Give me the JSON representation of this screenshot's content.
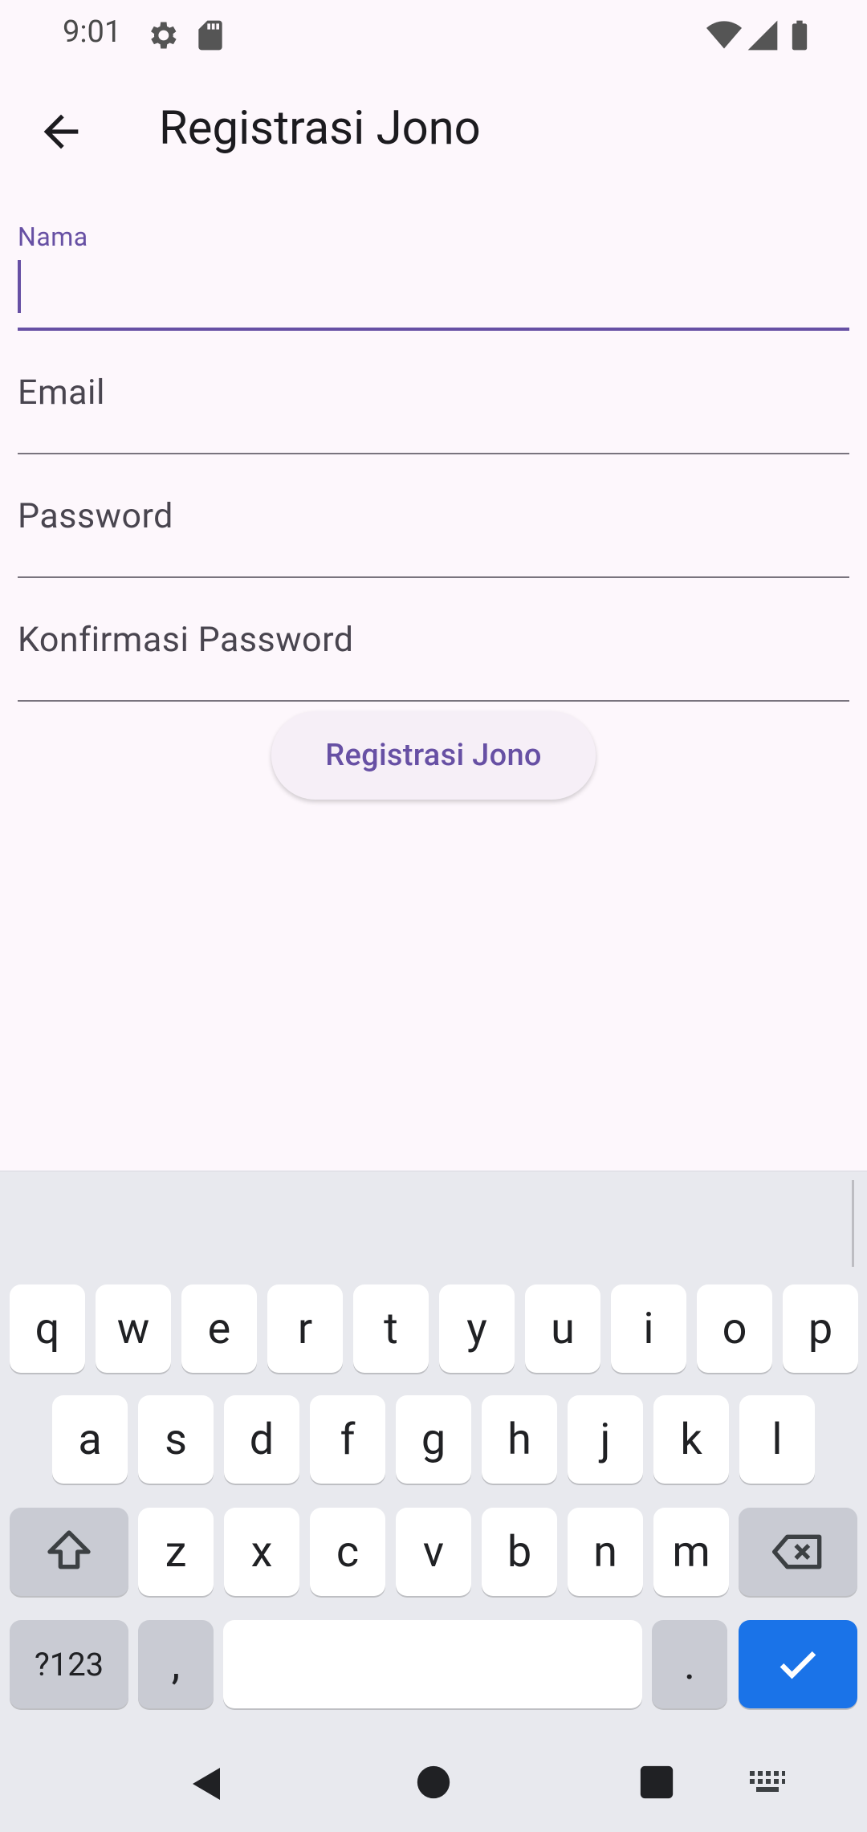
{
  "status": {
    "time": "9:01"
  },
  "appbar": {
    "title": "Registrasi Jono"
  },
  "form": {
    "fields": [
      {
        "label": "Nama",
        "value": ""
      },
      {
        "label": "Email",
        "value": ""
      },
      {
        "label": "Password",
        "value": ""
      },
      {
        "label": "Konfirmasi Password",
        "value": ""
      }
    ],
    "submit_label": "Registrasi Jono"
  },
  "keyboard": {
    "row1": [
      "q",
      "w",
      "e",
      "r",
      "t",
      "y",
      "u",
      "i",
      "o",
      "p"
    ],
    "row2": [
      "a",
      "s",
      "d",
      "f",
      "g",
      "h",
      "j",
      "k",
      "l"
    ],
    "row3": [
      "z",
      "x",
      "c",
      "v",
      "b",
      "n",
      "m"
    ],
    "symbols_label": "?123",
    "comma": ",",
    "period": "."
  },
  "colors": {
    "primary": "#6750A4",
    "background": "#FDF7FC",
    "enter": "#1A73E8"
  }
}
